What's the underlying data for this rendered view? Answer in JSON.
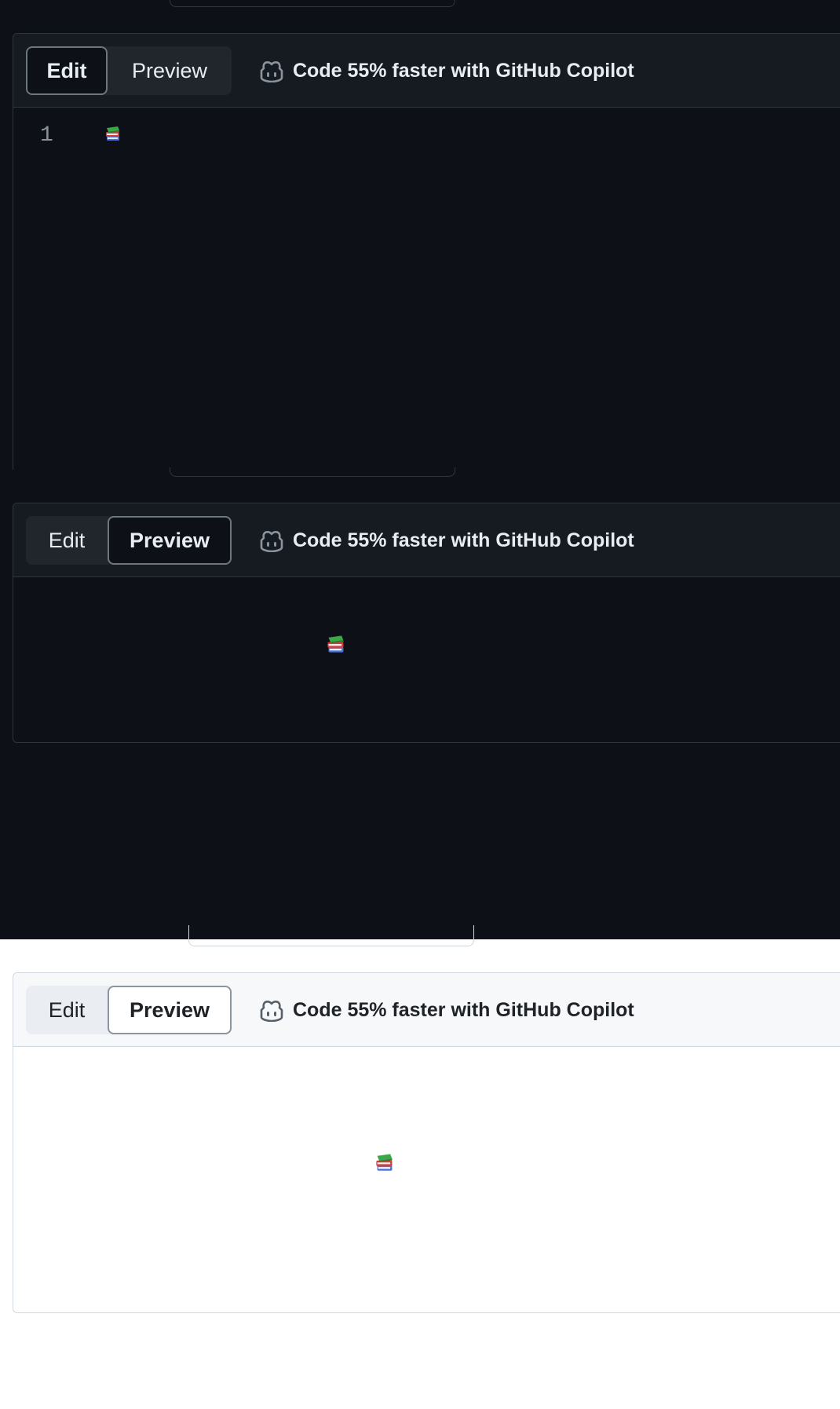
{
  "editor_edit_mode": {
    "tabs": {
      "edit": "Edit",
      "preview": "Preview"
    },
    "active_tab": "edit",
    "copilot_promo": "Code 55% faster with GitHub Copilot",
    "line_number": "1",
    "content_icon": "books-emoji"
  },
  "editor_preview_dark": {
    "tabs": {
      "edit": "Edit",
      "preview": "Preview"
    },
    "active_tab": "preview",
    "copilot_promo": "Code 55% faster with GitHub Copilot",
    "content_icon": "books-emoji"
  },
  "editor_preview_light": {
    "tabs": {
      "edit": "Edit",
      "preview": "Preview"
    },
    "active_tab": "preview",
    "copilot_promo": "Code 55% faster with GitHub Copilot",
    "content_icon": "books-emoji"
  },
  "colors": {
    "dark_bg": "#0d1117",
    "dark_header": "#161b22",
    "dark_border": "#30363d",
    "light_bg": "#ffffff",
    "light_header": "#f6f8fa",
    "light_border": "#d0d7de"
  }
}
